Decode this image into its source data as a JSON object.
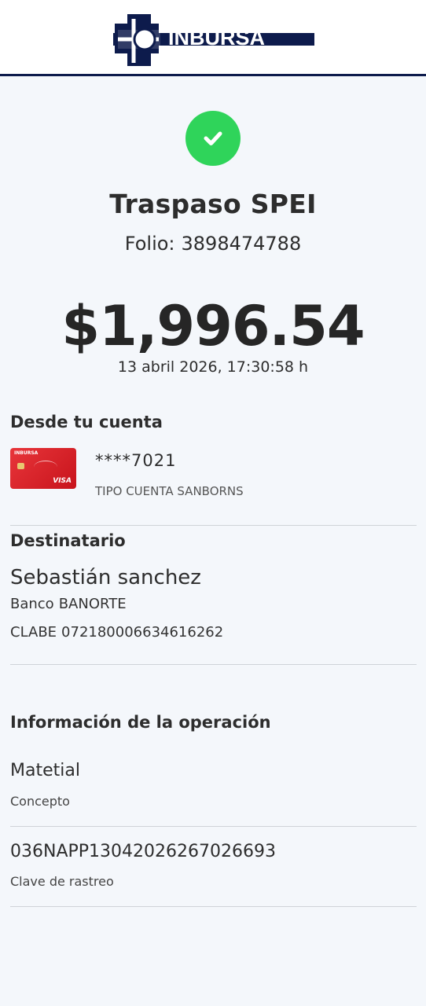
{
  "header": {
    "brand": "INBURSA"
  },
  "status": {
    "icon": "check-circle-icon",
    "color": "#2fd45a"
  },
  "transfer": {
    "title": "Traspaso SPEI",
    "folio_label": "Folio:",
    "folio": "3898474788",
    "amount": "$1,996.54",
    "datetime": "13 abril 2026, 17:30:58 h"
  },
  "from": {
    "title": "Desde tu cuenta",
    "card_icon": "credit-card-icon",
    "card_brand": "INBURSA",
    "card_network": "VISA",
    "account_number": "****7021",
    "account_type": "TIPO CUENTA SANBORNS"
  },
  "recipient": {
    "title": "Destinatario",
    "name": "Sebastián sanchez",
    "bank_label": "Banco",
    "bank": "BANORTE",
    "clabe_label": "CLABE",
    "clabe": "072180006634616262"
  },
  "operation": {
    "title": "Información de la operación",
    "concept_value": "Matetial",
    "concept_label": "Concepto",
    "tracking_value": "036NAPP13042026267026693",
    "tracking_label": "Clave de rastreo"
  },
  "colors": {
    "brand_navy": "#0d1b4c",
    "success": "#2fd45a",
    "card_red": "#d82027"
  }
}
